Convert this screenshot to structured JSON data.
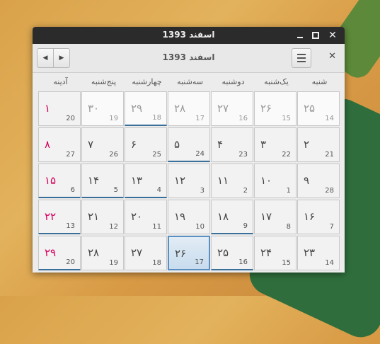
{
  "window": {
    "title": "اسفند 1393"
  },
  "header": {
    "month_title": "1393 اسفند",
    "prev_label": "◀",
    "next_label": "▶"
  },
  "weekdays": [
    "شنبه",
    "یک‌شنبه",
    "دوشنبه",
    "سه‌شنبه",
    "چهارشنبه",
    "پنج‌شنبه",
    "آدینه"
  ],
  "weeks": [
    [
      {
        "p": "۲۵",
        "g": "14",
        "other": true
      },
      {
        "p": "۲۶",
        "g": "15",
        "other": true
      },
      {
        "p": "۲۷",
        "g": "16",
        "other": true
      },
      {
        "p": "۲۸",
        "g": "17",
        "other": true
      },
      {
        "p": "۲۹",
        "g": "18",
        "other": true,
        "mark": true
      },
      {
        "p": "۳۰",
        "g": "19",
        "other": true
      },
      {
        "p": "۱",
        "g": "20",
        "holiday": true
      }
    ],
    [
      {
        "p": "۲",
        "g": "21"
      },
      {
        "p": "۳",
        "g": "22"
      },
      {
        "p": "۴",
        "g": "23"
      },
      {
        "p": "۵",
        "g": "24",
        "mark": true
      },
      {
        "p": "۶",
        "g": "25"
      },
      {
        "p": "۷",
        "g": "26"
      },
      {
        "p": "۸",
        "g": "27",
        "holiday": true
      }
    ],
    [
      {
        "p": "۹",
        "g": "28"
      },
      {
        "p": "۱۰",
        "g": "1"
      },
      {
        "p": "۱۱",
        "g": "2"
      },
      {
        "p": "۱۲",
        "g": "3"
      },
      {
        "p": "۱۳",
        "g": "4",
        "mark": true
      },
      {
        "p": "۱۴",
        "g": "5",
        "mark": true
      },
      {
        "p": "۱۵",
        "g": "6",
        "holiday": true,
        "mark": true
      }
    ],
    [
      {
        "p": "۱۶",
        "g": "7"
      },
      {
        "p": "۱۷",
        "g": "8"
      },
      {
        "p": "۱۸",
        "g": "9",
        "mark": true
      },
      {
        "p": "۱۹",
        "g": "10"
      },
      {
        "p": "۲۰",
        "g": "11"
      },
      {
        "p": "۲۱",
        "g": "12"
      },
      {
        "p": "۲۲",
        "g": "13",
        "holiday": true,
        "mark": true
      }
    ],
    [
      {
        "p": "۲۳",
        "g": "14"
      },
      {
        "p": "۲۴",
        "g": "15"
      },
      {
        "p": "۲۵",
        "g": "16",
        "mark": true
      },
      {
        "p": "۲۶",
        "g": "17",
        "selected": true
      },
      {
        "p": "۲۷",
        "g": "18"
      },
      {
        "p": "۲۸",
        "g": "19"
      },
      {
        "p": "۲۹",
        "g": "20",
        "holiday": true,
        "mark": true
      }
    ]
  ],
  "colors": {
    "holiday": "#d6005e",
    "mark": "#3a6f9a",
    "titlebar": "#2b2b2b"
  }
}
